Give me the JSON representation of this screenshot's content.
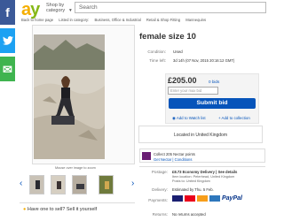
{
  "social": {
    "facebook": "f",
    "twitter": "t",
    "email": "✉"
  },
  "header": {
    "logo_a": "a",
    "logo_y": "y",
    "shop_by": "Shop by category",
    "search_placeholder": "Search"
  },
  "breadcrumbs": [
    "Back to home page",
    "Listed in category:",
    "Business, Office & Industrial",
    "Retail & Shop Fitting",
    "Mannequins"
  ],
  "gallery": {
    "caption": "Have one to sell? Sell it yourself"
  },
  "thumbnails": 4,
  "gallery_caption_small": "Mouse over image to zoom",
  "item": {
    "title": "female size 10",
    "condition_label": "Condition:",
    "condition_value": "Used",
    "time_label": "Time left:",
    "time_value": "3d 14h (07 Nov, 2015  20:16:12 GMT)",
    "price": "£205.00",
    "bids": "0 bids",
    "bid_placeholder": "Enter your max bid",
    "submit_label": "Submit bid",
    "watch_label": "Add to Watch list",
    "collection_label": "Add to collection",
    "located": "Located in United Kingdom"
  },
  "promo": {
    "line1": "Collect 205 Nectar points",
    "line2": "Get Nectar | Conditions"
  },
  "shipping": {
    "postage_label": "Postage:",
    "postage_value": "£8.73  Economy Delivery | See details",
    "postage_sub": "Item location: Peterhead, United Kingdom",
    "postage_sub2": "Posts to: United Kingdom",
    "delivery_label": "Delivery:",
    "delivery_value": "Estimated by Thu. 5 Feb.",
    "payments_label": "Payments:",
    "payments_value": "PayPal",
    "returns_label": "Returns:",
    "returns_value": "No returns accepted"
  },
  "colors": {
    "facebook": "#3b5998",
    "twitter": "#1da1f2",
    "email": "#3fb44f",
    "button": "#0654ba"
  }
}
